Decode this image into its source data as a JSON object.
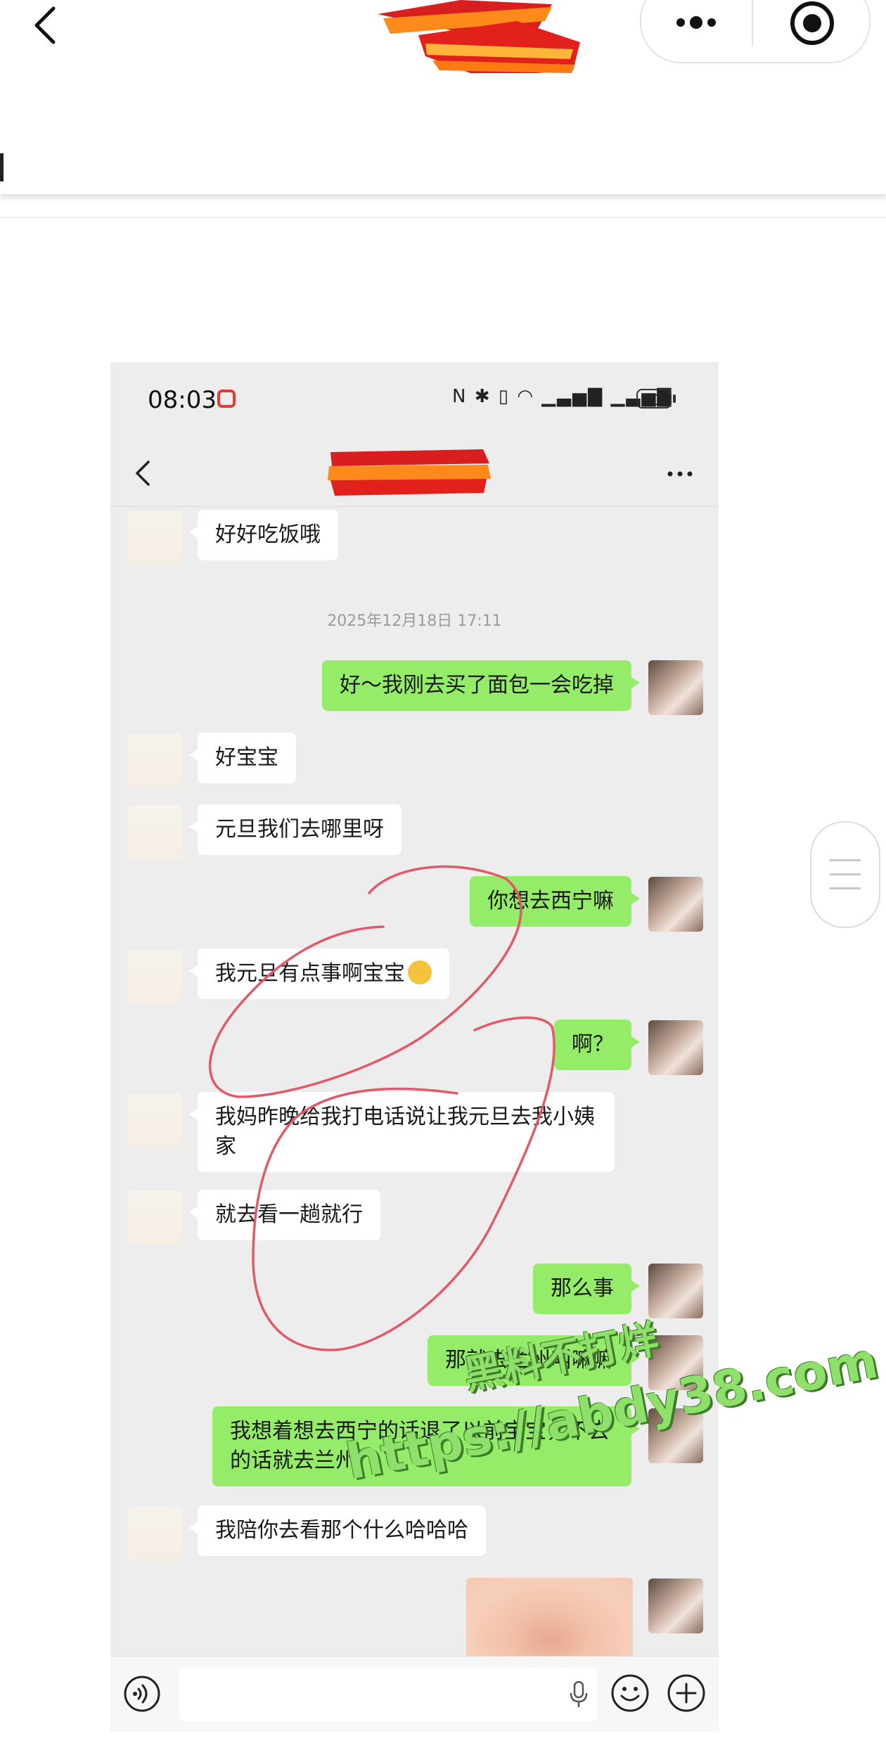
{
  "status_bar": {
    "time": "08:03",
    "battery": "83",
    "icons": [
      "nfc-icon",
      "bluetooth-icon",
      "vibrate-icon",
      "wifi-icon",
      "signal-icon",
      "signal-icon"
    ]
  },
  "messages": [
    {
      "side": "left",
      "text": "好好吃饭哦"
    },
    {
      "type": "timestamp",
      "text": "2025年12月18日 17:11"
    },
    {
      "side": "right",
      "text": "好～我刚去买了面包一会吃掉"
    },
    {
      "side": "left",
      "text": "好宝宝"
    },
    {
      "side": "left",
      "text": "元旦我们去哪里呀"
    },
    {
      "side": "right",
      "text": "你想去西宁嘛"
    },
    {
      "side": "left",
      "text": "我元旦有点事啊宝宝"
    },
    {
      "side": "right",
      "text": "啊？"
    },
    {
      "side": "left",
      "text": "我妈昨晚给我打电话说让我元旦去我小姨家"
    },
    {
      "side": "left",
      "text": "就去看一趟就行"
    },
    {
      "side": "right",
      "text": "那么事"
    },
    {
      "side": "right",
      "text": "那就去兰州叫嘛嘛"
    },
    {
      "side": "right",
      "text": "我想着想去西宁的话退了以前宝宝，不去的话就去兰州"
    },
    {
      "side": "left",
      "text": "我陪你去看那个什么哈哈哈"
    },
    {
      "side": "right",
      "type": "image"
    }
  ],
  "watermark": {
    "line1": "黑料不打烊",
    "line2": "https://abdy38.com"
  },
  "colors": {
    "sent_bubble": "#95ec69",
    "received_bubble": "#ffffff",
    "chat_bg": "#ededed",
    "annotation": "#e05a6a",
    "watermark": "#8ee06a"
  }
}
